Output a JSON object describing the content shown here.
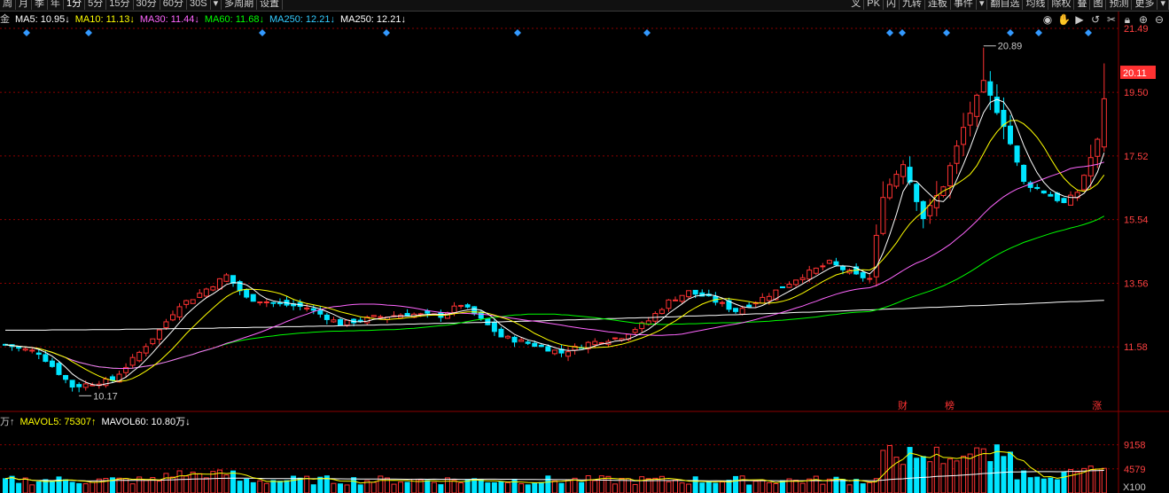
{
  "toolbar": {
    "left": [
      "周",
      "月",
      "季",
      "年",
      "1分",
      "5分",
      "15分",
      "30分",
      "60分",
      "30S",
      "▾",
      "多周期",
      "设置"
    ],
    "right": [
      "叉",
      "PK",
      "闪",
      "九转",
      "连板",
      "事件",
      "▾",
      "翻自选",
      "均线",
      "除权",
      "叠",
      "图",
      "预测",
      "更多",
      "▾"
    ]
  },
  "ma_legend": {
    "prefix": "金",
    "items": [
      {
        "text": "MA5: 10.95↓",
        "color": "#ffffff"
      },
      {
        "text": "MA10: 11.13↓",
        "color": "#ffff00"
      },
      {
        "text": "MA30: 11.44↓",
        "color": "#ff66ff"
      },
      {
        "text": "MA60: 11.68↓",
        "color": "#00ff00"
      },
      {
        "text": "MA250: 12.21↓",
        "color": "#33ccff"
      },
      {
        "text": "MA250: 12.21↓",
        "color": "#ffffff"
      }
    ]
  },
  "icons": [
    "eye-icon",
    "hand-icon",
    "play-icon",
    "undo-icon",
    "scissors-icon",
    "lock-icon",
    "zoom-in-icon",
    "zoom-out-icon"
  ],
  "vol_legend": {
    "items": [
      {
        "text": "万↑",
        "color": "#c8c8c8"
      },
      {
        "text": "MAVOL5: 75307↑",
        "color": "#ffff00"
      },
      {
        "text": "MAVOL60: 10.80万↓",
        "color": "#ffffff"
      }
    ]
  },
  "colors": {
    "up": "#ff3232",
    "down": "#00e5ff",
    "grid": "#8b0000",
    "axis": "#8b0000"
  },
  "chart_data": {
    "type": "candlestick",
    "price_axis": {
      "min": 9.6,
      "max": 21.49,
      "ticks": [
        21.49,
        19.5,
        17.52,
        15.54,
        13.56,
        11.58
      ]
    },
    "current_price": "20.11",
    "annotations": [
      {
        "label": "20.89",
        "index": 146
      },
      {
        "label": "10.17",
        "index": 11
      }
    ],
    "event_markers": [
      {
        "label": "财",
        "index": 134
      },
      {
        "label": "榜",
        "index": 141
      },
      {
        "label": "涨",
        "index": 163
      }
    ],
    "volume_axis": {
      "ticks": [
        9158,
        4579
      ],
      "unit_label": "X100"
    },
    "candles": [],
    "ma5": [],
    "ma10": [],
    "ma30": [],
    "ma60": [],
    "ma250": [],
    "volume": []
  }
}
